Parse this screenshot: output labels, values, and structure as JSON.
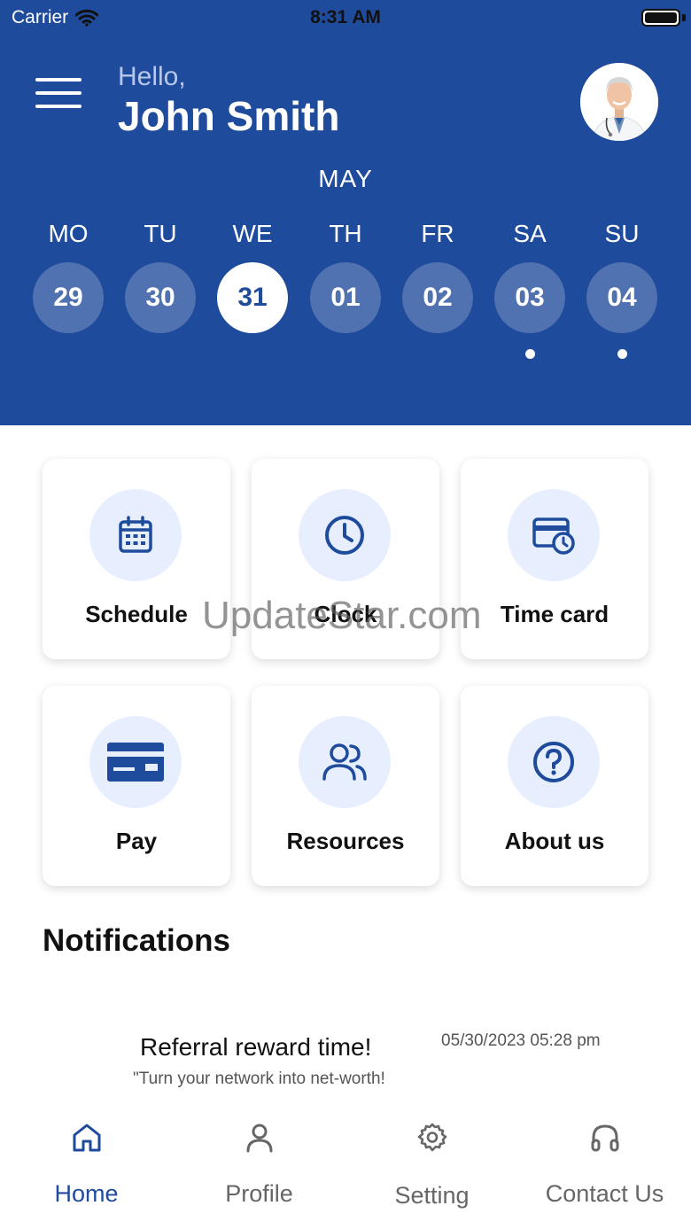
{
  "status_bar": {
    "carrier": "Carrier",
    "time": "8:31 AM"
  },
  "header": {
    "greeting": "Hello,",
    "user_name": "John Smith",
    "month": "MAY"
  },
  "week": [
    {
      "day": "MO",
      "date": "29",
      "selected": false,
      "has_event": false
    },
    {
      "day": "TU",
      "date": "30",
      "selected": false,
      "has_event": false
    },
    {
      "day": "WE",
      "date": "31",
      "selected": true,
      "has_event": false
    },
    {
      "day": "TH",
      "date": "01",
      "selected": false,
      "has_event": false
    },
    {
      "day": "FR",
      "date": "02",
      "selected": false,
      "has_event": false
    },
    {
      "day": "SA",
      "date": "03",
      "selected": false,
      "has_event": true
    },
    {
      "day": "SU",
      "date": "04",
      "selected": false,
      "has_event": true
    }
  ],
  "tiles": [
    {
      "label": "Schedule",
      "icon": "calendar-icon"
    },
    {
      "label": "Clock",
      "icon": "clock-icon"
    },
    {
      "label": "Time card",
      "icon": "time-card-icon"
    },
    {
      "label": "Pay",
      "icon": "credit-card-icon"
    },
    {
      "label": "Resources",
      "icon": "users-icon"
    },
    {
      "label": "About us",
      "icon": "help-icon"
    }
  ],
  "watermark": "UpdateStar.com",
  "notifications": {
    "title": "Notifications",
    "items": [
      {
        "heading": "Referral reward time!",
        "date": "05/30/2023 05:28 pm",
        "body": "\"Turn your network into net-worth!"
      }
    ]
  },
  "bottom_nav": [
    {
      "label": "Home",
      "icon": "home-icon",
      "active": true
    },
    {
      "label": "Profile",
      "icon": "user-icon",
      "active": false
    },
    {
      "label": "Setting",
      "icon": "gear-icon",
      "active": false
    },
    {
      "label": "Contact Us",
      "icon": "headphones-icon",
      "active": false
    }
  ],
  "colors": {
    "primary": "#1f4b9c",
    "icon_bg": "#e7efff",
    "nav_inactive": "#666666"
  }
}
